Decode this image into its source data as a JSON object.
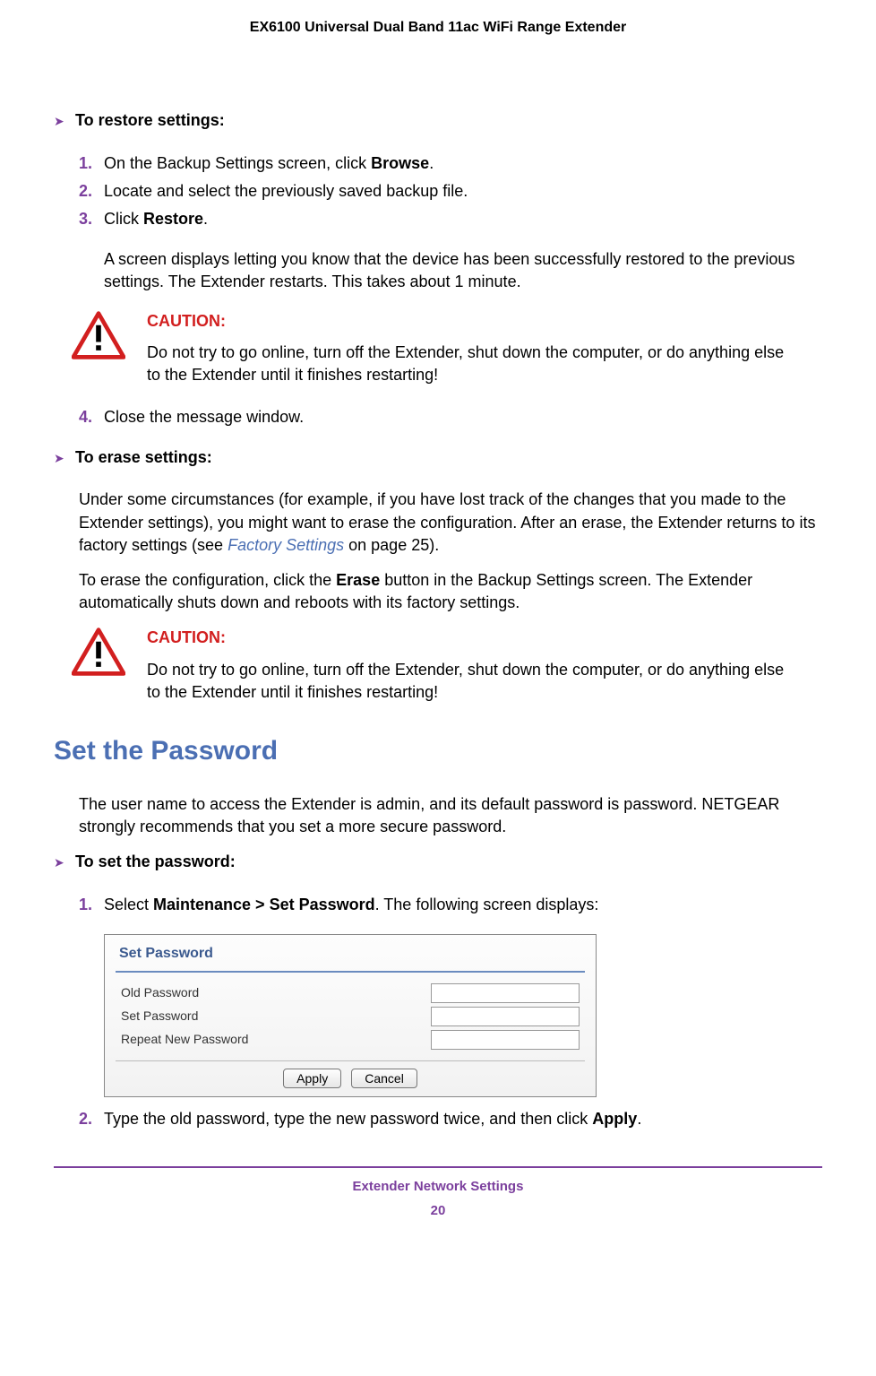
{
  "header": "EX6100 Universal Dual Band 11ac WiFi Range Extender",
  "restore": {
    "title": "To restore settings:",
    "step1_pre": "On the Backup Settings screen, click ",
    "step1_bold": "Browse",
    "step1_post": ".",
    "step2": "Locate and select the previously saved backup file.",
    "step3_pre": "Click ",
    "step3_bold": "Restore",
    "step3_post": ".",
    "step3_sub": "A screen displays letting you know that the device has been successfully restored to the previous settings. The Extender restarts. This takes about 1 minute.",
    "step4": "Close the message window."
  },
  "caution": {
    "label": "CAUTION:",
    "text": "Do not try to go online, turn off the Extender, shut down the computer, or do anything else to the Extender until it finishes restarting!"
  },
  "erase": {
    "title": "To erase settings:",
    "p1_pre": "Under some circumstances (for example, if you have lost track of the changes that you made to the Extender settings), you might want to erase the configuration. After an erase, the Extender returns to its factory settings (see ",
    "p1_link": "Factory Settings",
    "p1_post": " on page 25).",
    "p2_pre": "To erase the configuration, click the ",
    "p2_bold": "Erase",
    "p2_post": " button in the Backup Settings screen. The Extender automatically shuts down and reboots with its factory settings."
  },
  "setpw": {
    "heading": "Set the Password",
    "intro": "The user name to access the Extender is admin, and its default password is password. NETGEAR strongly recommends that you set a more secure password.",
    "title": "To set the password:",
    "step1_pre": "Select ",
    "step1_bold": "Maintenance > Set Password",
    "step1_post": ". The following screen displays:",
    "panel": {
      "title": "Set Password",
      "old": "Old Password",
      "new": "Set Password",
      "repeat": "Repeat New Password",
      "apply": "Apply",
      "cancel": "Cancel"
    },
    "step2_pre": "Type the old password, type the new password twice, and then click ",
    "step2_bold": "Apply",
    "step2_post": "."
  },
  "footer": {
    "title": "Extender Network Settings",
    "page": "20"
  }
}
